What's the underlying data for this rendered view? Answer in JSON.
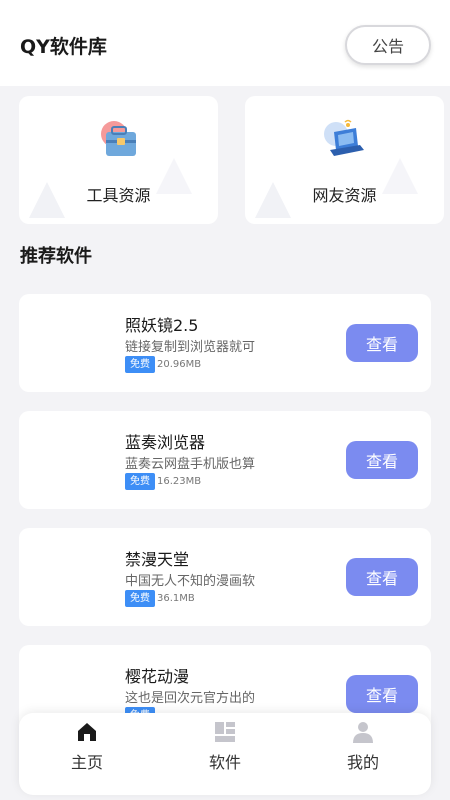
{
  "header": {
    "title": "QY软件库",
    "notice_label": "公告"
  },
  "cards": [
    {
      "label": "工具资源"
    },
    {
      "label": "网友资源"
    }
  ],
  "section": {
    "title": "推荐软件"
  },
  "apps": [
    {
      "name": "照妖镜2.5",
      "desc": "链接复制到浏览器就可",
      "badge": "免费",
      "size": "20.96MB",
      "button": "查看"
    },
    {
      "name": "蓝奏浏览器",
      "desc": "蓝奏云网盘手机版也算",
      "badge": "免费",
      "size": "16.23MB",
      "button": "查看"
    },
    {
      "name": "禁漫天堂",
      "desc": "中国无人不知的漫画软",
      "badge": "免费",
      "size": "36.1MB",
      "button": "查看"
    },
    {
      "name": "樱花动漫",
      "desc": "这也是回次元官方出的",
      "badge": "免费",
      "size": "",
      "button": "查看"
    }
  ],
  "nav": {
    "items": [
      {
        "label": "主页",
        "icon": "home-icon"
      },
      {
        "label": "软件",
        "icon": "grid-icon"
      },
      {
        "label": "我的",
        "icon": "user-icon"
      }
    ]
  },
  "colors": {
    "accent": "#7b8bf0",
    "badge": "#3d8ef6",
    "background": "#f3f3f6"
  }
}
